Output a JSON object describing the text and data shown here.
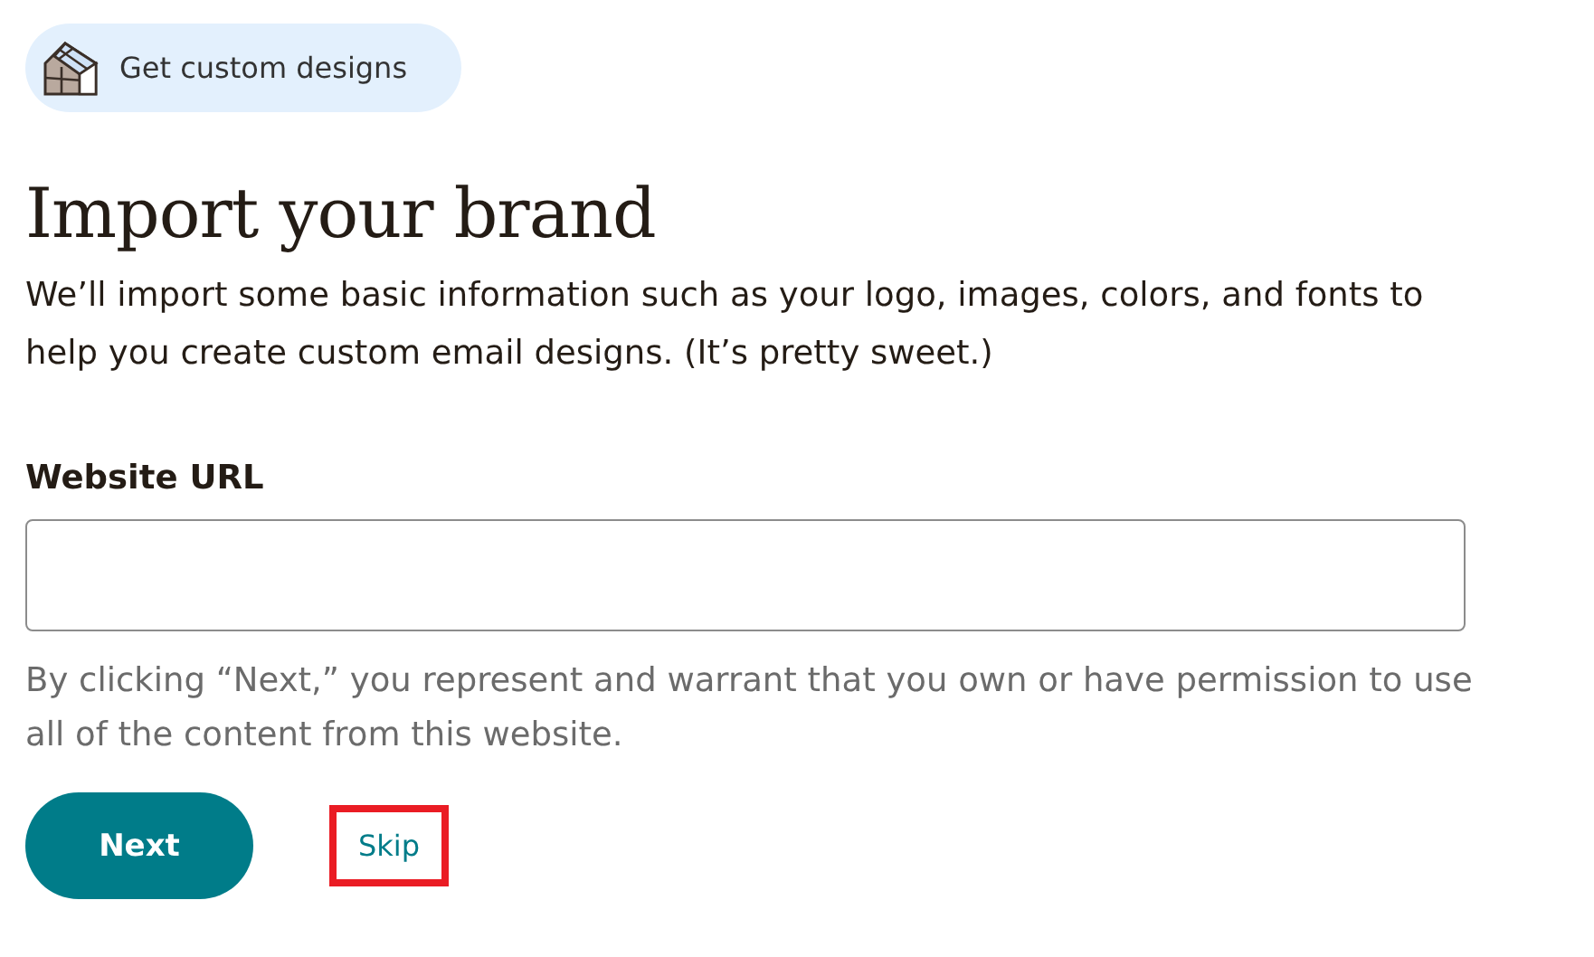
{
  "badge": {
    "label": "Get custom designs"
  },
  "title": "Import your brand",
  "description": "We’ll import some basic information such as your logo, images, colors, and fonts to help you create custom email designs. (It’s pretty sweet.)",
  "field": {
    "label": "Website URL"
  },
  "disclaimer": "By clicking “Next,” you represent and warrant that you own or have permission to use all of the content from this website.",
  "buttons": [
    {
      "kind": "primary",
      "label": "Next",
      "highlighted": false
    },
    {
      "kind": "link",
      "label": "Skip",
      "highlighted": true
    }
  ]
}
